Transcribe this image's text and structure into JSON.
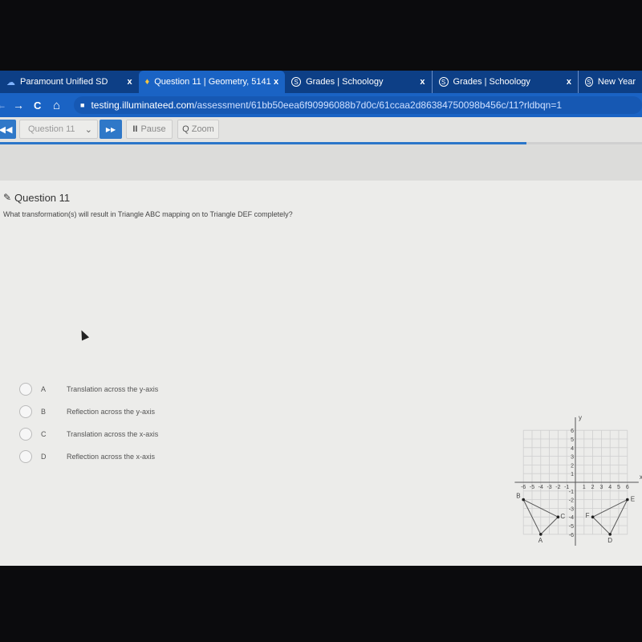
{
  "tabs": [
    {
      "label": "Paramount Unified SD",
      "icon": "cloud-icon",
      "active": false
    },
    {
      "label": "Question 11 | Geometry, 5141",
      "icon": "illuminate-icon",
      "active": true
    },
    {
      "label": "Grades | Schoology",
      "icon": "schoology-icon",
      "active": false
    },
    {
      "label": "Grades | Schoology",
      "icon": "schoology-icon",
      "active": false
    },
    {
      "label": "New Year",
      "icon": "schoology-icon",
      "active": false
    }
  ],
  "close_glyph": "x",
  "nav": {
    "back": "←",
    "forward": "→",
    "reload": "C",
    "home": "⌂",
    "lock": "🔒"
  },
  "url": {
    "host": "testing.illuminateed.com",
    "path": "/assessment/61bb50eea6f90996088b7d0c/61ccaa2d86384750098b456c/11?rldbqn=1"
  },
  "toolbar": {
    "prev": "◀◀",
    "question_select": "Question 11",
    "next": "▶▶",
    "pause": "Pause",
    "zoom": "Zoom"
  },
  "progress_percent": 82,
  "question": {
    "title": "Question 11",
    "text": "What transformation(s) will result in Triangle ABC mapping on to Triangle DEF completely?"
  },
  "options": [
    {
      "letter": "A",
      "label": "Translation across the y-axis"
    },
    {
      "letter": "B",
      "label": "Reflection across the y-axis"
    },
    {
      "letter": "C",
      "label": "Translation across the x-axis"
    },
    {
      "letter": "D",
      "label": "Reflection across the x-axis"
    }
  ],
  "chart_data": {
    "type": "scatter",
    "xlabel": "x",
    "ylabel": "y",
    "xlim": [
      -6,
      6
    ],
    "ylim": [
      -6,
      6
    ],
    "grid": true,
    "ticks": [
      -6,
      -5,
      -4,
      -3,
      -2,
      -1,
      1,
      2,
      3,
      4,
      5,
      6
    ],
    "triangles": [
      {
        "points": [
          {
            "label": "A",
            "x": -4,
            "y": -6
          },
          {
            "label": "B",
            "x": -6,
            "y": -2
          },
          {
            "label": "C",
            "x": -2,
            "y": -4
          }
        ]
      },
      {
        "points": [
          {
            "label": "D",
            "x": 4,
            "y": -6
          },
          {
            "label": "E",
            "x": 6,
            "y": -2
          },
          {
            "label": "F",
            "x": 2,
            "y": -4
          }
        ]
      }
    ]
  }
}
